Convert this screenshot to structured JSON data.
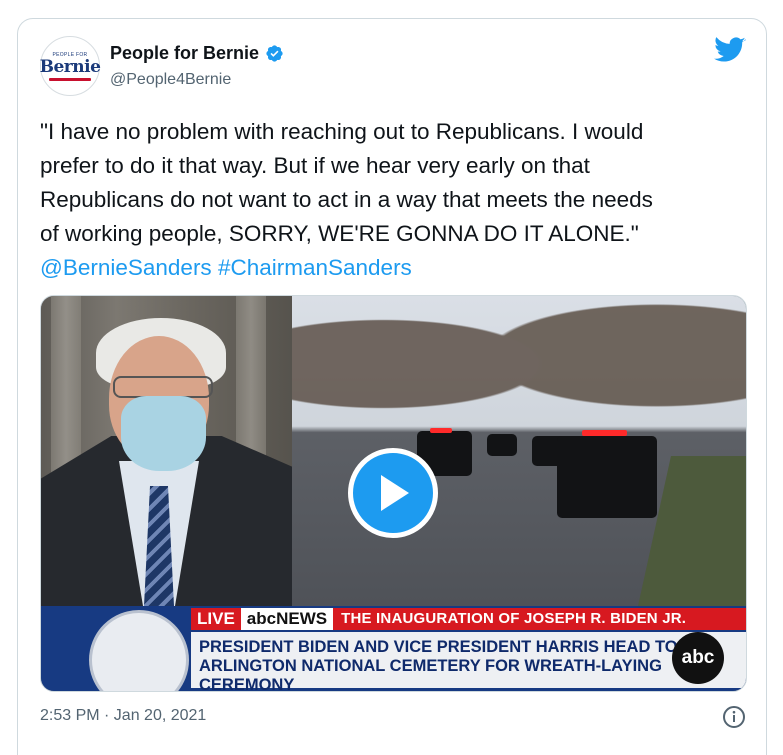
{
  "tweet": {
    "author_name": "People for Bernie",
    "handle": "@People4Bernie",
    "avatar_small_text": "PEOPLE FOR",
    "avatar_text": "Bernie",
    "text_lines": [
      "\"I have no problem with reaching out to Republicans. I would",
      "prefer to do it that way. But if we hear very early on that",
      "Republicans do not want to act in a way that meets the needs",
      "of working people, SORRY, WE'RE GONNA DO IT ALONE.\""
    ],
    "mention": "@BernieSanders",
    "hashtag": "#ChairmanSanders",
    "timestamp": "2:53 PM · Jan 20, 2021"
  },
  "video": {
    "live_label": "LIVE",
    "network_label": "abcNEWS",
    "banner": "THE INAUGURATION OF JOSEPH R. BIDEN JR.",
    "headline_line1": "PRESIDENT BIDEN AND VICE PRESIDENT HARRIS HEAD TO",
    "headline_line2": "ARLINGTON NATIONAL CEMETERY FOR WREATH-LAYING CEREMONY",
    "corner_logo": "abc"
  },
  "colors": {
    "accent": "#1d9bf0",
    "text": "#0f1419",
    "secondary_text": "#536471",
    "border": "#cfd9de",
    "live_red": "#d71920",
    "broadcast_blue": "#173a82"
  },
  "icons": [
    "verified-badge-icon",
    "twitter-bird-icon",
    "play-icon",
    "info-icon"
  ]
}
